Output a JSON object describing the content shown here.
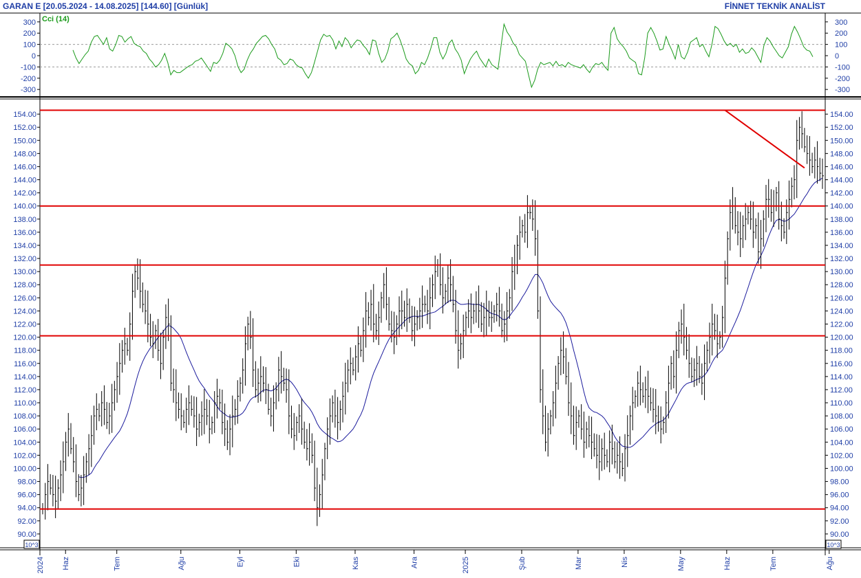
{
  "header": {
    "title": "GARAN E  [20.05.2024 - 14.08.2025]  [144.60]  [Günlük]",
    "brand": "FİNNET TEKNİK ANALİST"
  },
  "colors": {
    "price_bars": "#000000",
    "moving_average": "#1a1a9c",
    "cci_line": "#1a9a1a",
    "horizontal_levels": "#e00000",
    "axis_text": "#1f3ea6",
    "grid": "#9a9a9a"
  },
  "chart_data": [
    {
      "type": "line",
      "title": "Cci (14)",
      "ylim": [
        -360,
        360
      ],
      "yticks": [
        300,
        200,
        100,
        0,
        -100,
        -200,
        -300
      ],
      "ytick_labels": [
        "300",
        "200",
        "100",
        "0",
        "-100",
        "-200",
        "-300"
      ],
      "reference_lines": [
        100,
        -100
      ],
      "series": [
        {
          "values": [
            50,
            -20,
            -70,
            -30,
            10,
            40,
            120,
            170,
            180,
            140,
            100,
            160,
            60,
            40,
            100,
            180,
            170,
            120,
            150,
            170,
            110,
            90,
            80,
            40,
            20,
            -30,
            -60,
            -100,
            -80,
            -40,
            20,
            -60,
            -170,
            -130,
            -150,
            -150,
            -130,
            -110,
            -90,
            -80,
            -50,
            -40,
            -20,
            -60,
            -100,
            -140,
            -60,
            -70,
            -40,
            20,
            110,
            90,
            60,
            0,
            -100,
            -150,
            -120,
            -40,
            20,
            60,
            110,
            140,
            170,
            180,
            150,
            100,
            60,
            -20,
            -40,
            -80,
            -70,
            -30,
            -40,
            -80,
            -100,
            -110,
            -160,
            -200,
            -150,
            -60,
            40,
            140,
            190,
            170,
            180,
            140,
            60,
            130,
            80,
            160,
            130,
            70,
            110,
            140,
            130,
            90,
            60,
            10,
            140,
            130,
            20,
            -60,
            -30,
            40,
            150,
            170,
            200,
            140,
            60,
            -30,
            -70,
            -90,
            -160,
            -130,
            -60,
            -80,
            -20,
            60,
            160,
            160,
            30,
            -30,
            20,
            110,
            140,
            60,
            20,
            -40,
            -160,
            -90,
            -30,
            10,
            40,
            -20,
            -60,
            -100,
            -30,
            -80,
            -100,
            -120,
            80,
            280,
            210,
            170,
            110,
            80,
            10,
            -20,
            -50,
            -170,
            -280,
            -220,
            -120,
            -60,
            -80,
            -70,
            -60,
            -90,
            -50,
            -90,
            -80,
            -100,
            -60,
            -80,
            -90,
            -100,
            -110,
            -80,
            -120,
            -150,
            -100,
            -70,
            -80,
            -60,
            -100,
            -130,
            200,
            250,
            150,
            110,
            80,
            40,
            -20,
            -40,
            -60,
            -160,
            -170,
            -20,
            200,
            250,
            200,
            130,
            50,
            60,
            170,
            100,
            40,
            -30,
            100,
            -10,
            -30,
            30,
            120,
            140,
            160,
            80,
            100,
            40,
            -10,
            100,
            260,
            240,
            190,
            130,
            90,
            110,
            80,
            100,
            30,
            60,
            20,
            30,
            70,
            40,
            -10,
            -60,
            90,
            160,
            130,
            80,
            40,
            0,
            -20,
            30,
            80,
            190,
            260,
            210,
            150,
            80,
            50,
            40,
            -10
          ]
        }
      ]
    },
    {
      "type": "candlestick",
      "title": "",
      "ylim": [
        88,
        156
      ],
      "yticks": [
        154,
        152,
        150,
        148,
        146,
        144,
        142,
        140,
        138,
        136,
        134,
        132,
        130,
        128,
        126,
        124,
        122,
        120,
        118,
        116,
        114,
        112,
        110,
        108,
        106,
        104,
        102,
        100,
        98,
        96,
        94,
        92,
        90
      ],
      "ytick_labels": [
        "154.00",
        "152.00",
        "150.00",
        "148.00",
        "146.00",
        "144.00",
        "142.00",
        "140.00",
        "138.00",
        "136.00",
        "134.00",
        "132.00",
        "130.00",
        "128.00",
        "126.00",
        "124.00",
        "122.00",
        "120.00",
        "118.00",
        "116.00",
        "114.00",
        "112.00",
        "110.00",
        "108.00",
        "106.00",
        "104.00",
        "102.00",
        "100.00",
        "98.00",
        "96.00",
        "94.00",
        "92.00",
        "90.00"
      ],
      "axis_corner_label": "10^3",
      "x_labels": [
        "2024",
        "Haz",
        "Tem",
        "Ağu",
        "Eyl",
        "Eki",
        "Kas",
        "Ara",
        "2025",
        "Şub",
        "Mar",
        "Nis",
        "May",
        "Haz",
        "Tem",
        "Ağu"
      ],
      "last_close": 144.6,
      "horizontal_levels": [
        154.6,
        140.0,
        131.0,
        120.2,
        93.8
      ],
      "trendline": {
        "from": [
          266,
          154.6
        ],
        "to": [
          297,
          145.8
        ]
      },
      "close": [
        93.8,
        96,
        98,
        97,
        96,
        95,
        97,
        99,
        101,
        104,
        106,
        103,
        101,
        98,
        96,
        97,
        99,
        101,
        103,
        105,
        108,
        109,
        108,
        110,
        109,
        107,
        108,
        110,
        112,
        114,
        116,
        118,
        119,
        118,
        122,
        127,
        130,
        129,
        127,
        125,
        124,
        122,
        120,
        119,
        121,
        118,
        116,
        120,
        123,
        122,
        113,
        112,
        110,
        109,
        108,
        107,
        109,
        110,
        109,
        108,
        106,
        107,
        108,
        109,
        108,
        106,
        107,
        110,
        111,
        110,
        107,
        106,
        104,
        106,
        108,
        109,
        111,
        113,
        115,
        119,
        122,
        120,
        115,
        112,
        113,
        114,
        113,
        112,
        109,
        108,
        110,
        112,
        115,
        114,
        113,
        112,
        108,
        106,
        105,
        107,
        108,
        106,
        104,
        103,
        104,
        102,
        97,
        94,
        96,
        99,
        103,
        106,
        108,
        110,
        108,
        107,
        109,
        111,
        113,
        115,
        116,
        115,
        117,
        119,
        118,
        121,
        124,
        123,
        125,
        122,
        121,
        123,
        126,
        128,
        125,
        122,
        121,
        120,
        122,
        124,
        124,
        123,
        125,
        123,
        121,
        122,
        123,
        124,
        125,
        125,
        124,
        126,
        128,
        130,
        131,
        128,
        126,
        127,
        129,
        128,
        125,
        121,
        118,
        119,
        121,
        123,
        124,
        123,
        124,
        125,
        124,
        122,
        123,
        124,
        123,
        123,
        124,
        125,
        124,
        121,
        122,
        124,
        126,
        130,
        131,
        134,
        136,
        137,
        136,
        139,
        139,
        138,
        135,
        124,
        112,
        108,
        104,
        106,
        108,
        110,
        113,
        116,
        118,
        117,
        114,
        110,
        108,
        105,
        107,
        108,
        106,
        104,
        106,
        105,
        104,
        103,
        102,
        101,
        103,
        102,
        101,
        104,
        103,
        101,
        102,
        101,
        100,
        103,
        105,
        108,
        110,
        111,
        113,
        112,
        111,
        112,
        111,
        110,
        109,
        108,
        107,
        106,
        107,
        110,
        113,
        116,
        114,
        118,
        121,
        122,
        120,
        118,
        116,
        114,
        115,
        116,
        114,
        113,
        116,
        118,
        120,
        122,
        121,
        119,
        120,
        123,
        129,
        135,
        139,
        140,
        137,
        136,
        135,
        137,
        138,
        139,
        138,
        136,
        137,
        133,
        135,
        138,
        141,
        141,
        139,
        140,
        142,
        138,
        137,
        136,
        139,
        141,
        143,
        144,
        150,
        152,
        151,
        149,
        148,
        147,
        146,
        147,
        146,
        145,
        144.6
      ]
    }
  ]
}
